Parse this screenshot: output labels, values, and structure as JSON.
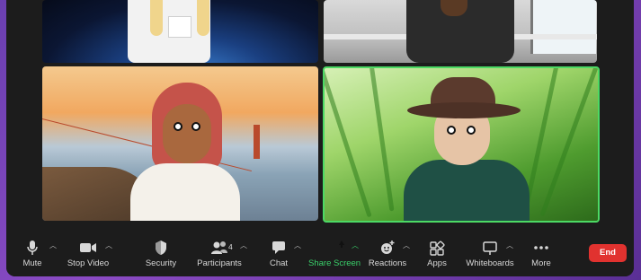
{
  "toolbar": {
    "mute_label": "Mute",
    "stop_video_label": "Stop Video",
    "security_label": "Security",
    "participants_label": "Participants",
    "participants_count": "4",
    "chat_label": "Chat",
    "share_screen_label": "Share Screen",
    "reactions_label": "Reactions",
    "apps_label": "Apps",
    "whiteboards_label": "Whiteboards",
    "more_label": "More",
    "end_label": "End"
  },
  "colors": {
    "active_speaker_border": "#4cd964",
    "share_accent": "#1fc25a",
    "end_button": "#e1322f"
  },
  "icons": {
    "mute": "microphone-icon",
    "stop_video": "video-camera-icon",
    "security": "shield-icon",
    "participants": "people-icon",
    "chat": "speech-bubble-icon",
    "share_screen": "share-arrow-icon",
    "reactions": "emoji-add-icon",
    "apps": "apps-grid-icon",
    "whiteboards": "whiteboard-icon",
    "more": "ellipsis-icon"
  }
}
